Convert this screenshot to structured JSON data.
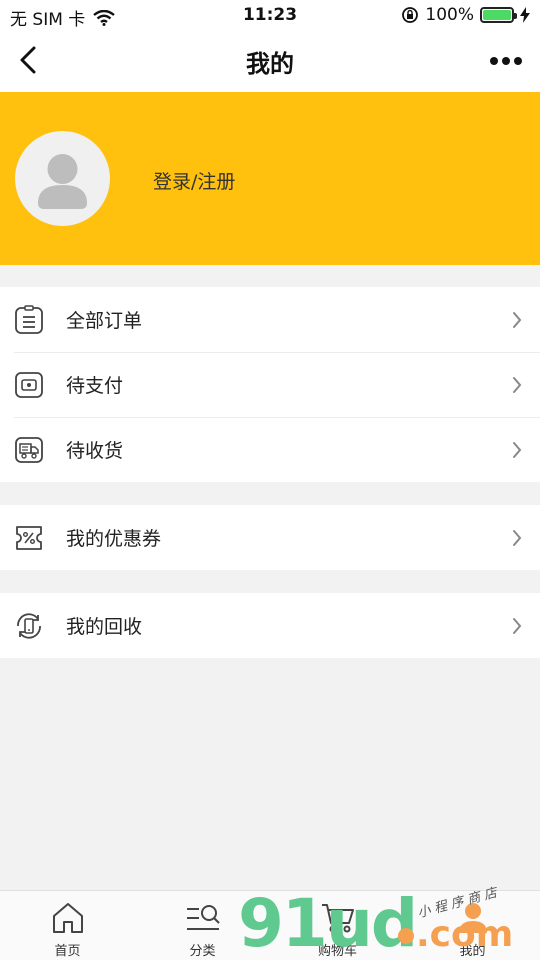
{
  "status_bar": {
    "carrier": "无 SIM 卡",
    "time": "11:23",
    "battery": "100%",
    "battery_level": 1.0
  },
  "nav": {
    "title": "我的"
  },
  "profile": {
    "login_label": "登录/注册"
  },
  "menu": {
    "orders": [
      {
        "label": "全部订单",
        "icon": "order-list-icon"
      },
      {
        "label": "待支付",
        "icon": "wallet-icon"
      },
      {
        "label": "待收货",
        "icon": "truck-icon"
      }
    ],
    "coupon": {
      "label": "我的优惠券",
      "icon": "coupon-icon"
    },
    "recycle": {
      "label": "我的回收",
      "icon": "recycle-phone-icon"
    }
  },
  "tabs": [
    {
      "label": "首页",
      "icon": "home-icon"
    },
    {
      "label": "分类",
      "icon": "category-search-icon"
    },
    {
      "label": "购物车",
      "icon": "cart-icon"
    },
    {
      "label": "我的",
      "icon": "user-icon",
      "active": true
    }
  ],
  "watermark": {
    "brand_number": "91",
    "brand_letters": "ud",
    "brand_suffix": ".com",
    "tagline": "小 程 序 商 店"
  },
  "colors": {
    "accent": "#ffc10e",
    "watermark_green": "#5fc98f",
    "watermark_orange": "#f5a050"
  }
}
